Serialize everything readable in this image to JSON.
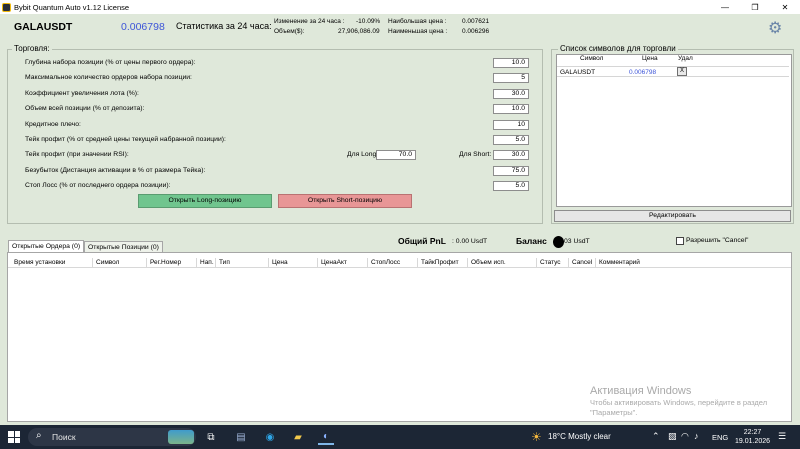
{
  "window": {
    "title": "Bybit Quantum Auto v1.12 License",
    "minimize_icon": "—",
    "maximize_icon": "❐",
    "close_icon": "✕"
  },
  "header": {
    "symbol": "GALAUSDT",
    "price": "0.006798",
    "stats_label": "Статистика за 24 часа:",
    "change_label": "Изменение за 24 часа :",
    "change_value": "-10.09%",
    "volume_label": "Объем($):",
    "volume_value": "27,906,086.09",
    "high_label": "Наибольшая цена :",
    "high_value": "0.007621",
    "low_label": "Наименьшая цена :",
    "low_value": "0.006296"
  },
  "trading": {
    "title": "Торговля:",
    "params": [
      {
        "label": "Глубина набора позиции (% от цены первого ордера):",
        "value": "10.0"
      },
      {
        "label": "Максимальное количество ордеров набора позиции:",
        "value": "5"
      },
      {
        "label": "Коэффициент увеличения лота (%):",
        "value": "30.0"
      },
      {
        "label": "Объем всей позиции (% от депозита):",
        "value": "10.0"
      },
      {
        "label": "Кредитное плечо:",
        "value": "10"
      },
      {
        "label": "Тейк профит (% от средней цены текущей набранной позиции):",
        "value": "5.0"
      },
      {
        "label": "Тейк профит (при значении RSI):",
        "value": ""
      },
      {
        "label": "Безубыток (Дистанция активации в % от размера Тейка):",
        "value": "75.0"
      },
      {
        "label": "Стоп Лосс (% от последнего ордера позиции):",
        "value": "5.0"
      }
    ],
    "rsi_long_label": "Для Long:",
    "rsi_long_value": "70.0",
    "rsi_short_label": "Для Short:",
    "rsi_short_value": "30.0",
    "open_long": "Открыть Long-позицию",
    "open_short": "Открыть Short-позицию"
  },
  "symbols_list": {
    "title": "Список символов для торговли",
    "col_symbol": "Символ",
    "col_price": "Цена",
    "col_delete": "Удал",
    "rows": [
      {
        "symbol": "GALAUSDT",
        "price": "0.006798",
        "delete": "X"
      }
    ],
    "edit_button": "Редактировать"
  },
  "bottom": {
    "tab_orders": "Открытые Ордера (0)",
    "tab_positions": "Открытые Позиции (0)",
    "pnl_label": "Общий PnL",
    "pnl_value": ":  0.00  UsdT",
    "balance_label": "Баланс",
    "balance_value": "03  UsdT",
    "allow_cancel": "Разрешить \"Cancel\"",
    "columns": [
      "Время установки",
      "Символ",
      "Рег.Номер",
      "Нап.",
      "Тип",
      "Цена",
      "ЦенаАкт",
      "СтопЛосс",
      "ТайкПрофит",
      "Объем исп.",
      "Статус",
      "Cancel",
      "Комментарий"
    ]
  },
  "watermark": {
    "title": "Активация Windows",
    "text": "Чтобы активировать Windows, перейдите в раздел \"Параметры\"."
  },
  "taskbar": {
    "search": "Поиск",
    "weather_icon": "☀",
    "temperature": "18°C",
    "weather": "Mostly clear",
    "lang": "ENG",
    "time": "22:27",
    "date": "19.01.2026"
  }
}
